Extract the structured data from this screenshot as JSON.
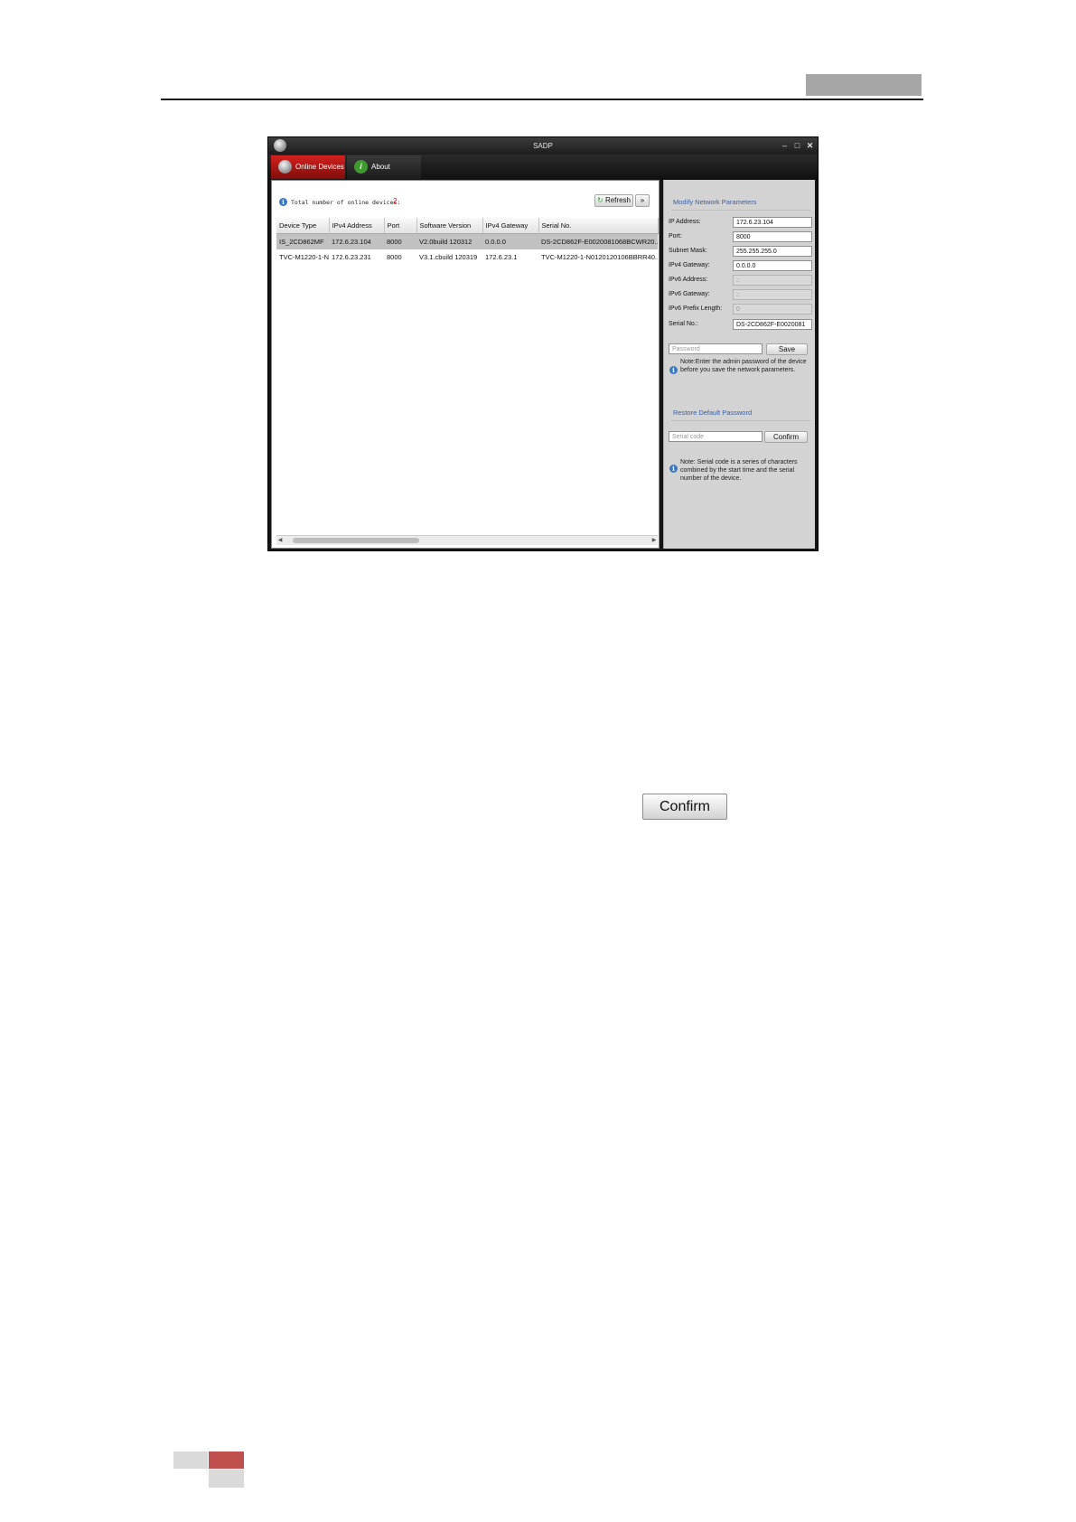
{
  "window": {
    "title": "SADP",
    "controls": [
      "minimize-icon",
      "maximize-icon",
      "close-icon"
    ]
  },
  "tabs": [
    {
      "label": "Online Devices",
      "icon": "devices-icon",
      "active": true
    },
    {
      "label": "About",
      "icon": "info-icon",
      "active": false
    }
  ],
  "device_list": {
    "total_label": "Total number of online devices:",
    "total_count": "2",
    "refresh_label": "Refresh",
    "expand_label": "»",
    "columns": [
      "Device Type",
      "IPv4 Address",
      "Port",
      "Software Version",
      "IPv4 Gateway",
      "Serial No."
    ],
    "rows": [
      [
        "IS_2CD862MF",
        "172.6.23.104",
        "8000",
        "V2.0build 120312",
        "0.0.0.0",
        "DS-2CD862F-E0020081068BCWR20..."
      ],
      [
        "TVC-M1220-1-N",
        "172.6.23.231",
        "8000",
        "V3.1.cbuild 120319",
        "172.6.23.1",
        "TVC-M1220-1-N0120120106BBRR40..."
      ]
    ],
    "selected_row": 0
  },
  "modify": {
    "title": "Modify Network Parameters",
    "fields": [
      {
        "label": "IP Address:",
        "value": "172.6.23.104",
        "enabled": true
      },
      {
        "label": "Port:",
        "value": "8000",
        "enabled": true
      },
      {
        "label": "Subnet Mask:",
        "value": "255.255.255.0",
        "enabled": true
      },
      {
        "label": "IPv4 Gateway:",
        "value": "0.0.0.0",
        "enabled": true
      },
      {
        "label": "IPv6 Address:",
        "value": "::",
        "enabled": false
      },
      {
        "label": "IPv6 Gateway:",
        "value": "::",
        "enabled": false
      },
      {
        "label": "IPv6 Prefix Length:",
        "value": "0",
        "enabled": false
      },
      {
        "label": "Serial No.:",
        "value": "DS-2CD862F-E0020081",
        "enabled": true
      }
    ],
    "password_placeholder": "Password",
    "save_label": "Save",
    "note": "Note:Enter the admin password of the device before you save the network parameters."
  },
  "restore": {
    "title": "Restore Default Password",
    "serial_placeholder": "Serial code",
    "confirm_label": "Confirm",
    "note": "Note: Serial code is a series of characters combined by the start time and the serial number of the device."
  },
  "standalone_confirm_label": "Confirm",
  "colors": {
    "tab_active": "#c0201e",
    "title_blue": "#3b5fa0",
    "count_red": "#d01010",
    "footer_red": "#c0504d"
  }
}
